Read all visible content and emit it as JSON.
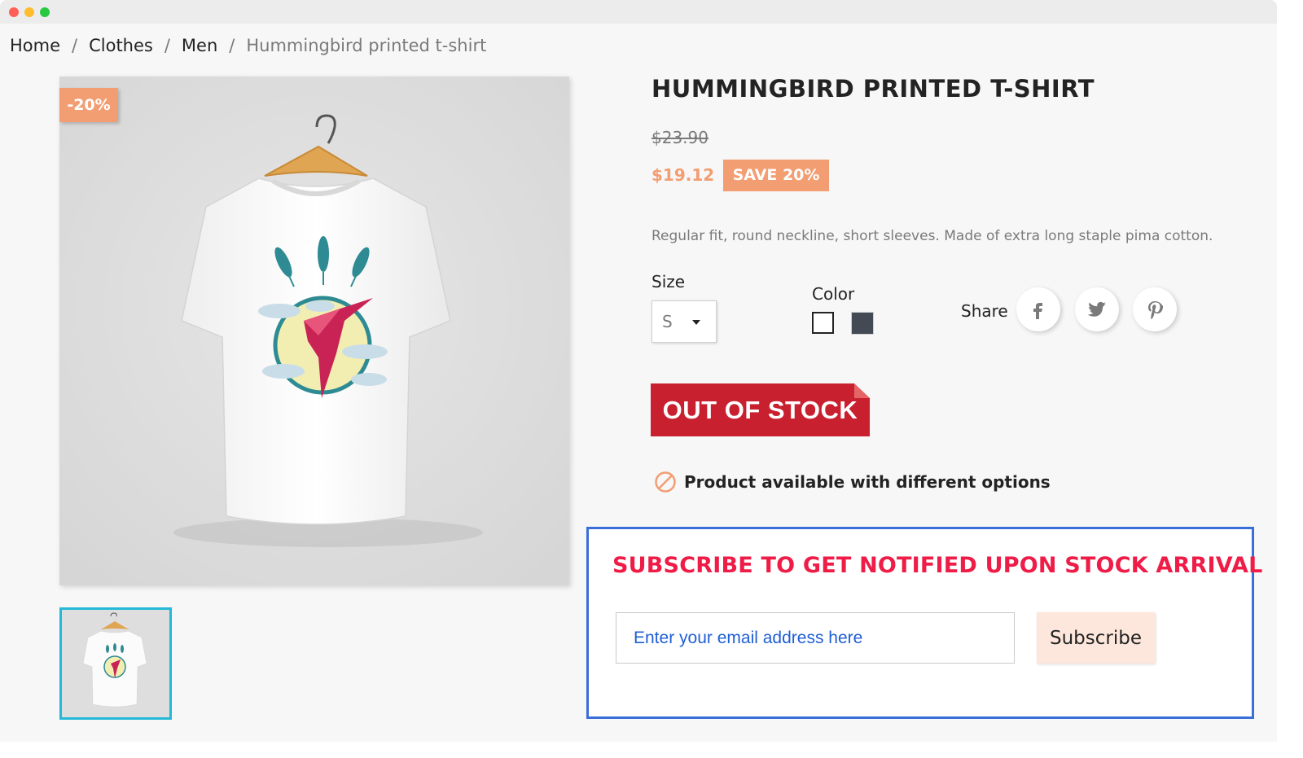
{
  "breadcrumb": {
    "items": [
      "Home",
      "Clothes",
      "Men"
    ],
    "separator": "/",
    "current": "Hummingbird printed t-shirt"
  },
  "product": {
    "discount_flag": "-20%",
    "title": "HUMMINGBIRD PRINTED T-SHIRT",
    "regular_price": "$23.90",
    "price": "$19.12",
    "save_label": "SAVE 20%",
    "description": "Regular fit, round neckline, short sleeves. Made of extra long staple pima cotton.",
    "size_label": "Size",
    "size_value": "S",
    "color_label": "Color",
    "colors": [
      "#ffffff",
      "#434a54"
    ],
    "share_label": "Share",
    "social": [
      "facebook-icon",
      "twitter-icon",
      "pinterest-icon"
    ],
    "out_of_stock": "OUT OF STOCK",
    "availability_message": "Product available with different options"
  },
  "notify": {
    "title": "SUBSCRIBE TO GET NOTIFIED UPON STOCK ARRIVAL",
    "email_placeholder": "Enter your email address here",
    "button_label": "Subscribe"
  },
  "colors": {
    "accent": "#f39d72",
    "out_of_stock": "#c8202f",
    "notify_title": "#ee1c47",
    "notify_border": "#3a6ed8",
    "thumb_border": "#24b9d7"
  }
}
